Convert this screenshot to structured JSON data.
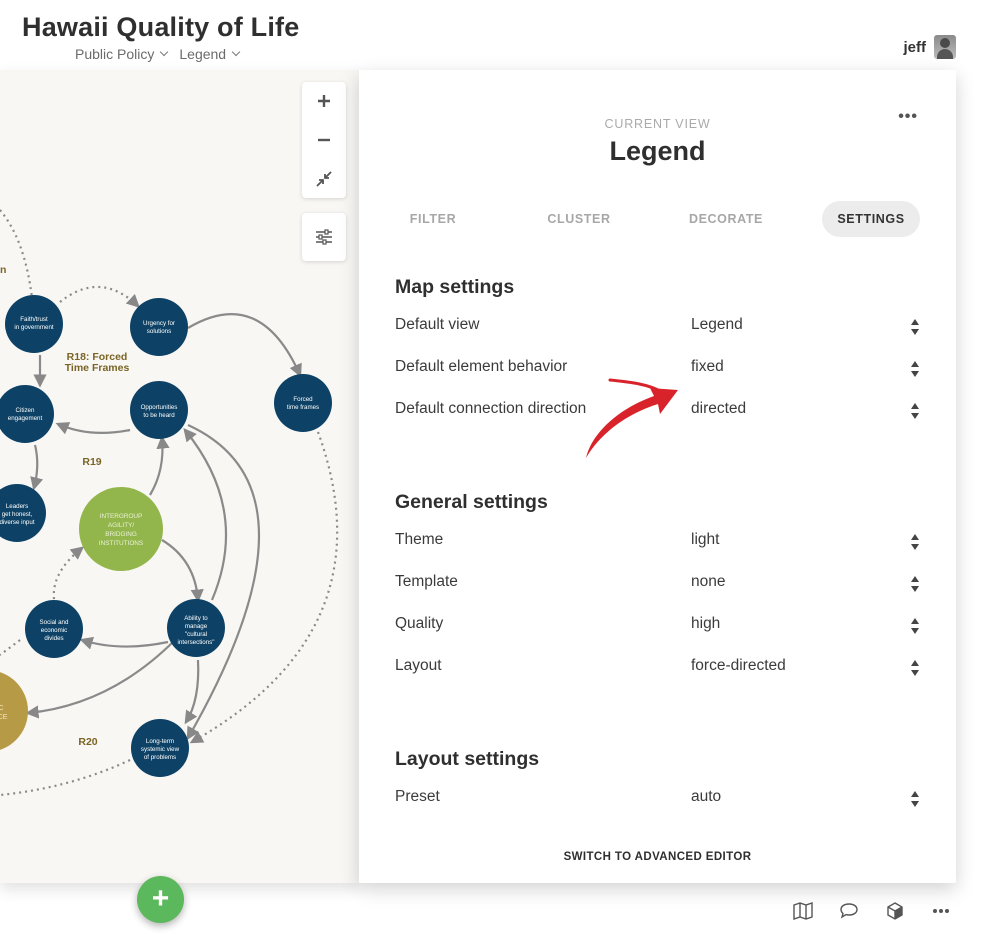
{
  "app": {
    "title": "Hawaii Quality of Life",
    "nav": [
      {
        "label": "Public Policy"
      },
      {
        "label": "Legend"
      }
    ],
    "user": {
      "name": "jeff"
    }
  },
  "map": {
    "zoom_in_label": "+",
    "zoom_out_label": "−",
    "nodes": {
      "faith": "Faith/trust in government",
      "urgency": "Urgency for solutions",
      "citizen": "Citizen engagement",
      "opportunities": "Opportunities to be heard",
      "forced": "Forced time frames",
      "leaders": "Leaders get honest, diverse input",
      "intergroup": "INTERGROUP AGILITY/ BRIDGING INSTITUTIONS",
      "social": "Social and economic divides",
      "ability": "Ability to manage \"cultural intersections\"",
      "longterm": "Long-term systemic view of problems",
      "gold_partial": "IC NCE"
    },
    "labels": {
      "r18": "R18: Forced Time Frames",
      "r19": "R19",
      "r20": "R20",
      "n_fragment": "n"
    },
    "colors": {
      "node_blue": "#0d4266",
      "node_green": "#93b64c",
      "node_gold": "#b79a45",
      "loop_label": "#7a6425"
    }
  },
  "settings": {
    "more_label": "•••",
    "caption": "CURRENT VIEW",
    "view_title": "Legend",
    "tabs": [
      {
        "label": "FILTER"
      },
      {
        "label": "CLUSTER"
      },
      {
        "label": "DECORATE"
      },
      {
        "label": "SETTINGS",
        "active": true
      }
    ],
    "sections": {
      "map": {
        "title": "Map settings",
        "rows": [
          {
            "label": "Default view",
            "value": "Legend"
          },
          {
            "label": "Default element behavior",
            "value": "fixed"
          },
          {
            "label": "Default connection direction",
            "value": "directed"
          }
        ]
      },
      "general": {
        "title": "General settings",
        "rows": [
          {
            "label": "Theme",
            "value": "light"
          },
          {
            "label": "Template",
            "value": "none"
          },
          {
            "label": "Quality",
            "value": "high"
          },
          {
            "label": "Layout",
            "value": "force-directed"
          }
        ]
      },
      "layout": {
        "title": "Layout settings",
        "rows": [
          {
            "label": "Preset",
            "value": "auto"
          }
        ]
      }
    },
    "advanced_link": "SWITCH TO ADVANCED EDITOR"
  },
  "fab": {
    "label": "+",
    "color": "#5cb85c"
  },
  "footer": {
    "icons": [
      "map-icon",
      "comment-icon",
      "cube-icon",
      "more-icon"
    ]
  },
  "annotation": {
    "arrow_color": "#d9232a"
  }
}
